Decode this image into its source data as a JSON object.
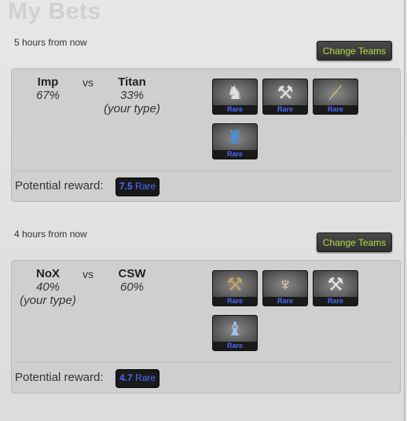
{
  "page": {
    "title": "My Bets"
  },
  "bets": [
    {
      "time": "5 hours from now",
      "change_label": "Change Teams",
      "team1": {
        "name": "Imp",
        "pct": "67%",
        "note": ""
      },
      "vs": "vs",
      "team2": {
        "name": "Titan",
        "pct": "33%",
        "note": "(your type)"
      },
      "items": [
        {
          "rarity": "Rare",
          "icon": "hero-figure-icon"
        },
        {
          "rarity": "Rare",
          "icon": "axe-icon"
        },
        {
          "rarity": "Rare",
          "icon": "scythe-icon"
        },
        {
          "rarity": "Rare",
          "icon": "blue-armor-icon"
        }
      ],
      "reward_label": "Potential reward:",
      "reward_value": "7.5",
      "reward_rarity": "Rare"
    },
    {
      "time": "4 hours from now",
      "change_label": "Change Teams",
      "team1": {
        "name": "NoX",
        "pct": "40%",
        "note": "(your type)"
      },
      "vs": "vs",
      "team2": {
        "name": "CSW",
        "pct": "60%",
        "note": ""
      },
      "items": [
        {
          "rarity": "Rare",
          "icon": "hammer-icon"
        },
        {
          "rarity": "Rare",
          "icon": "helmet-icon"
        },
        {
          "rarity": "Rare",
          "icon": "axe-icon"
        },
        {
          "rarity": "Rare",
          "icon": "hooded-figure-icon"
        }
      ],
      "reward_label": "Potential reward:",
      "reward_value": "4.7",
      "reward_rarity": "Rare"
    }
  ],
  "colors": {
    "rare": "#4b69ff",
    "button_text": "#b8d84a"
  }
}
